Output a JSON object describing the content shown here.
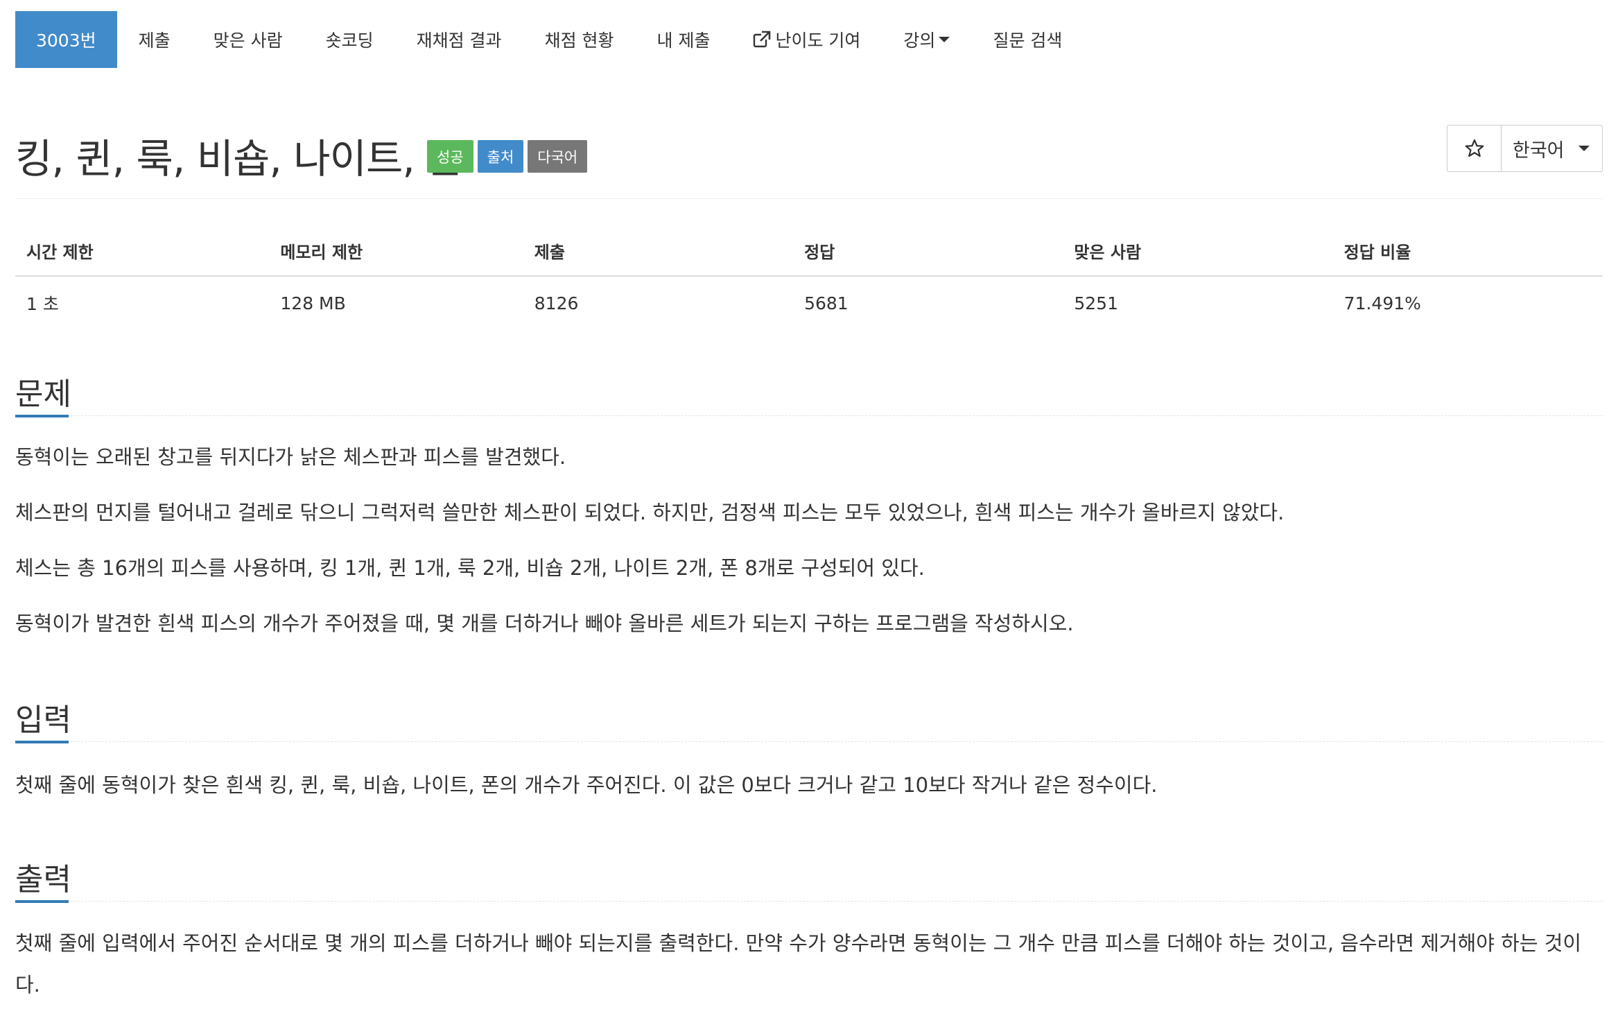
{
  "nav": {
    "problem_number": "3003번",
    "items": [
      {
        "label": "제출"
      },
      {
        "label": "맞은 사람"
      },
      {
        "label": "숏코딩"
      },
      {
        "label": "재채점 결과"
      },
      {
        "label": "채점 현황"
      },
      {
        "label": "내 제출"
      },
      {
        "label": "난이도 기여",
        "icon": "external-link-icon"
      },
      {
        "label": "강의",
        "icon": "caret-down-icon"
      },
      {
        "label": "질문 검색"
      }
    ]
  },
  "problem": {
    "title": "킹, 퀸, 룩, 비숍, 나이트, 폰",
    "badges": [
      {
        "label": "성공",
        "color": "#5cb85c"
      },
      {
        "label": "출처",
        "color": "#428bca"
      },
      {
        "label": "다국어",
        "color": "#777777"
      }
    ],
    "star_icon": "star-outline-icon",
    "language": "한국어"
  },
  "info_table": {
    "headers": [
      "시간 제한",
      "메모리 제한",
      "제출",
      "정답",
      "맞은 사람",
      "정답 비율"
    ],
    "values": [
      "1 초",
      "128 MB",
      "8126",
      "5681",
      "5251",
      "71.491%"
    ]
  },
  "sections": {
    "description": {
      "title": "문제",
      "paragraphs": [
        "동혁이는 오래된 창고를 뒤지다가 낡은 체스판과 피스를 발견했다.",
        "체스판의 먼지를 털어내고 걸레로 닦으니 그럭저럭 쓸만한 체스판이 되었다. 하지만, 검정색 피스는 모두 있었으나, 흰색 피스는 개수가 올바르지 않았다.",
        "체스는 총 16개의 피스를 사용하며, 킹 1개, 퀸 1개, 룩 2개, 비숍 2개, 나이트 2개, 폰 8개로 구성되어 있다.",
        "동혁이가 발견한 흰색 피스의 개수가 주어졌을 때, 몇 개를 더하거나 빼야 올바른 세트가 되는지 구하는 프로그램을 작성하시오."
      ]
    },
    "input": {
      "title": "입력",
      "paragraphs": [
        "첫째 줄에 동혁이가 찾은 흰색 킹, 퀸, 룩, 비숍, 나이트, 폰의 개수가 주어진다. 이 값은 0보다 크거나 같고 10보다 작거나 같은 정수이다."
      ]
    },
    "output": {
      "title": "출력",
      "paragraphs": [
        "첫째 줄에 입력에서 주어진 순서대로 몇 개의 피스를 더하거나 빼야 되는지를 출력한다. 만약 수가 양수라면 동혁이는 그 개수 만큼 피스를 더해야 하는 것이고, 음수라면 제거해야 하는 것이다."
      ]
    }
  },
  "colors": {
    "primary": "#428bca",
    "success": "#5cb85c",
    "default": "#777777"
  }
}
